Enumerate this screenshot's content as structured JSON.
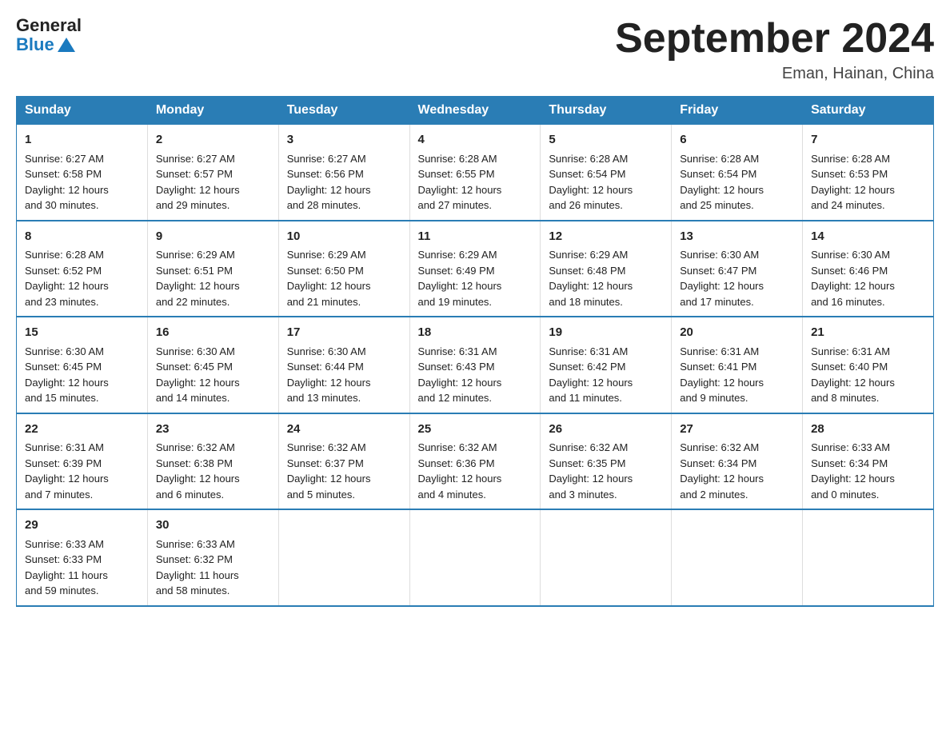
{
  "header": {
    "logo_general": "General",
    "logo_blue": "Blue",
    "title": "September 2024",
    "subtitle": "Eman, Hainan, China"
  },
  "days_of_week": [
    "Sunday",
    "Monday",
    "Tuesday",
    "Wednesday",
    "Thursday",
    "Friday",
    "Saturday"
  ],
  "weeks": [
    [
      {
        "num": "1",
        "sunrise": "6:27 AM",
        "sunset": "6:58 PM",
        "daylight": "12 hours and 30 minutes."
      },
      {
        "num": "2",
        "sunrise": "6:27 AM",
        "sunset": "6:57 PM",
        "daylight": "12 hours and 29 minutes."
      },
      {
        "num": "3",
        "sunrise": "6:27 AM",
        "sunset": "6:56 PM",
        "daylight": "12 hours and 28 minutes."
      },
      {
        "num": "4",
        "sunrise": "6:28 AM",
        "sunset": "6:55 PM",
        "daylight": "12 hours and 27 minutes."
      },
      {
        "num": "5",
        "sunrise": "6:28 AM",
        "sunset": "6:54 PM",
        "daylight": "12 hours and 26 minutes."
      },
      {
        "num": "6",
        "sunrise": "6:28 AM",
        "sunset": "6:54 PM",
        "daylight": "12 hours and 25 minutes."
      },
      {
        "num": "7",
        "sunrise": "6:28 AM",
        "sunset": "6:53 PM",
        "daylight": "12 hours and 24 minutes."
      }
    ],
    [
      {
        "num": "8",
        "sunrise": "6:28 AM",
        "sunset": "6:52 PM",
        "daylight": "12 hours and 23 minutes."
      },
      {
        "num": "9",
        "sunrise": "6:29 AM",
        "sunset": "6:51 PM",
        "daylight": "12 hours and 22 minutes."
      },
      {
        "num": "10",
        "sunrise": "6:29 AM",
        "sunset": "6:50 PM",
        "daylight": "12 hours and 21 minutes."
      },
      {
        "num": "11",
        "sunrise": "6:29 AM",
        "sunset": "6:49 PM",
        "daylight": "12 hours and 19 minutes."
      },
      {
        "num": "12",
        "sunrise": "6:29 AM",
        "sunset": "6:48 PM",
        "daylight": "12 hours and 18 minutes."
      },
      {
        "num": "13",
        "sunrise": "6:30 AM",
        "sunset": "6:47 PM",
        "daylight": "12 hours and 17 minutes."
      },
      {
        "num": "14",
        "sunrise": "6:30 AM",
        "sunset": "6:46 PM",
        "daylight": "12 hours and 16 minutes."
      }
    ],
    [
      {
        "num": "15",
        "sunrise": "6:30 AM",
        "sunset": "6:45 PM",
        "daylight": "12 hours and 15 minutes."
      },
      {
        "num": "16",
        "sunrise": "6:30 AM",
        "sunset": "6:45 PM",
        "daylight": "12 hours and 14 minutes."
      },
      {
        "num": "17",
        "sunrise": "6:30 AM",
        "sunset": "6:44 PM",
        "daylight": "12 hours and 13 minutes."
      },
      {
        "num": "18",
        "sunrise": "6:31 AM",
        "sunset": "6:43 PM",
        "daylight": "12 hours and 12 minutes."
      },
      {
        "num": "19",
        "sunrise": "6:31 AM",
        "sunset": "6:42 PM",
        "daylight": "12 hours and 11 minutes."
      },
      {
        "num": "20",
        "sunrise": "6:31 AM",
        "sunset": "6:41 PM",
        "daylight": "12 hours and 9 minutes."
      },
      {
        "num": "21",
        "sunrise": "6:31 AM",
        "sunset": "6:40 PM",
        "daylight": "12 hours and 8 minutes."
      }
    ],
    [
      {
        "num": "22",
        "sunrise": "6:31 AM",
        "sunset": "6:39 PM",
        "daylight": "12 hours and 7 minutes."
      },
      {
        "num": "23",
        "sunrise": "6:32 AM",
        "sunset": "6:38 PM",
        "daylight": "12 hours and 6 minutes."
      },
      {
        "num": "24",
        "sunrise": "6:32 AM",
        "sunset": "6:37 PM",
        "daylight": "12 hours and 5 minutes."
      },
      {
        "num": "25",
        "sunrise": "6:32 AM",
        "sunset": "6:36 PM",
        "daylight": "12 hours and 4 minutes."
      },
      {
        "num": "26",
        "sunrise": "6:32 AM",
        "sunset": "6:35 PM",
        "daylight": "12 hours and 3 minutes."
      },
      {
        "num": "27",
        "sunrise": "6:32 AM",
        "sunset": "6:34 PM",
        "daylight": "12 hours and 2 minutes."
      },
      {
        "num": "28",
        "sunrise": "6:33 AM",
        "sunset": "6:34 PM",
        "daylight": "12 hours and 0 minutes."
      }
    ],
    [
      {
        "num": "29",
        "sunrise": "6:33 AM",
        "sunset": "6:33 PM",
        "daylight": "11 hours and 59 minutes."
      },
      {
        "num": "30",
        "sunrise": "6:33 AM",
        "sunset": "6:32 PM",
        "daylight": "11 hours and 58 minutes."
      },
      null,
      null,
      null,
      null,
      null
    ]
  ],
  "labels": {
    "sunrise": "Sunrise:",
    "sunset": "Sunset:",
    "daylight": "Daylight:"
  }
}
